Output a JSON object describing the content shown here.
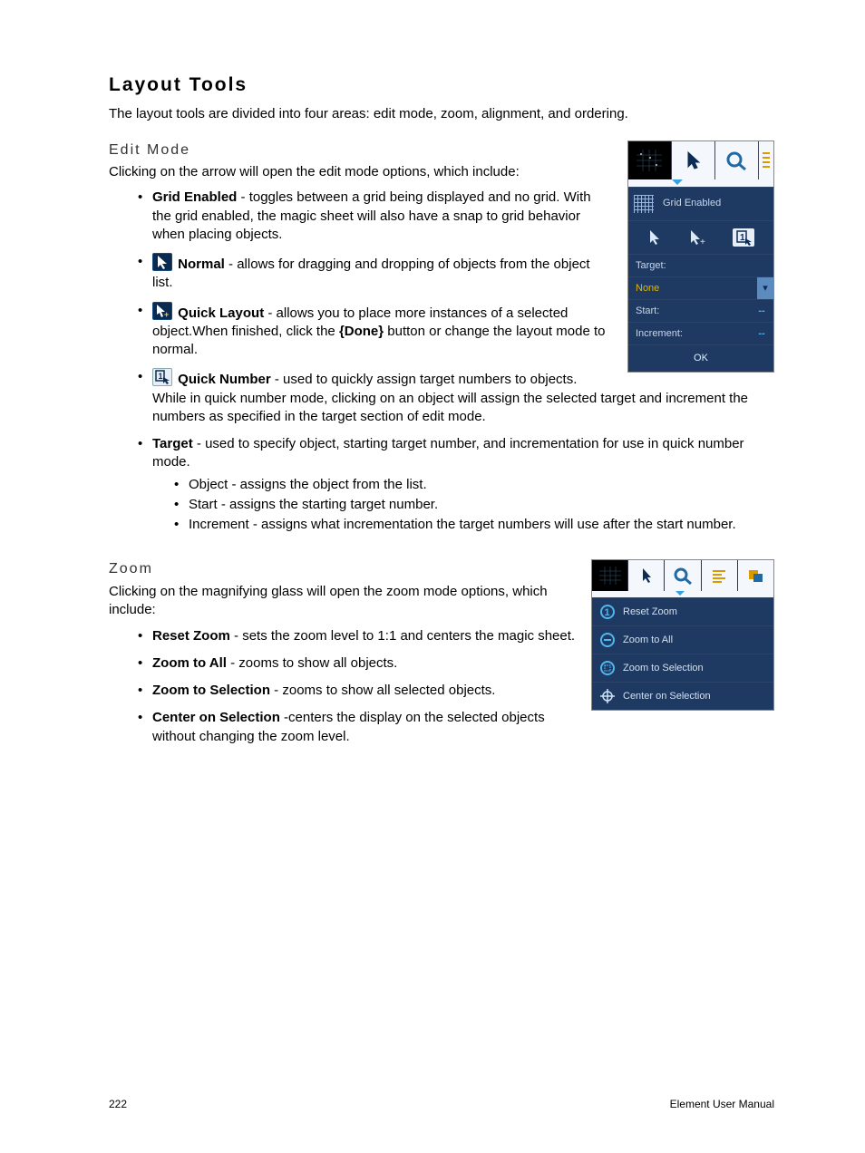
{
  "headings": {
    "h1": "Layout Tools",
    "edit": "Edit Mode",
    "zoom": "Zoom"
  },
  "intro": "The layout tools are divided into four areas: edit mode, zoom, alignment, and ordering.",
  "edit_lead": "Clicking on the arrow will open the edit mode options, which include:",
  "edit_items": {
    "grid": {
      "name": "Grid Enabled",
      "text": " - toggles between a grid being displayed and no grid. With the grid enabled, the magic sheet will also have a snap to grid behavior when placing objects."
    },
    "normal": {
      "name": "Normal",
      "text": " - allows for dragging and dropping of objects from the object list."
    },
    "quicklayout": {
      "name": "Quick Layout",
      "text_a": " - allows you to place more instances of a selected object.When finished, click the ",
      "done": "{Done}",
      "text_b": " button or change the layout mode to normal."
    },
    "quicknumber": {
      "name": "Quick Number",
      "text": " - used to quickly assign target numbers to objects. While in quick number mode, clicking on an object will assign the selected target and increment the numbers as specified in the target section of edit mode."
    },
    "target": {
      "name": "Target",
      "text": " - used to specify object, starting target number, and incrementation for use in quick number mode.",
      "sub": {
        "object": "Object - assigns the object from the list.",
        "start": "Start - assigns the starting target number.",
        "increment": "Increment - assigns what incrementation the target numbers will use after the start number."
      }
    }
  },
  "zoom_lead": "Clicking on the magnifying glass will open the zoom mode options, which include:",
  "zoom_items": {
    "reset": {
      "name": "Reset Zoom",
      "text": " - sets the zoom level to 1:1 and centers the magic sheet."
    },
    "all": {
      "name": "Zoom to All",
      "text": " - zooms to show all objects."
    },
    "sel": {
      "name": "Zoom to Selection",
      "text": " - zooms to show all selected objects."
    },
    "center": {
      "name": "Center on Selection",
      "text": " -centers the display on the selected objects without changing the zoom level."
    }
  },
  "panel1": {
    "grid_enabled": "Grid Enabled",
    "target": "Target:",
    "none": "None",
    "start": "Start:",
    "increment": "Increment:",
    "ok": "OK",
    "dash": "--"
  },
  "panel2": {
    "reset": "Reset Zoom",
    "all": "Zoom to All",
    "sel": "Zoom to Selection",
    "center": "Center on Selection"
  },
  "footer": {
    "page": "222",
    "title": "Element User Manual"
  }
}
